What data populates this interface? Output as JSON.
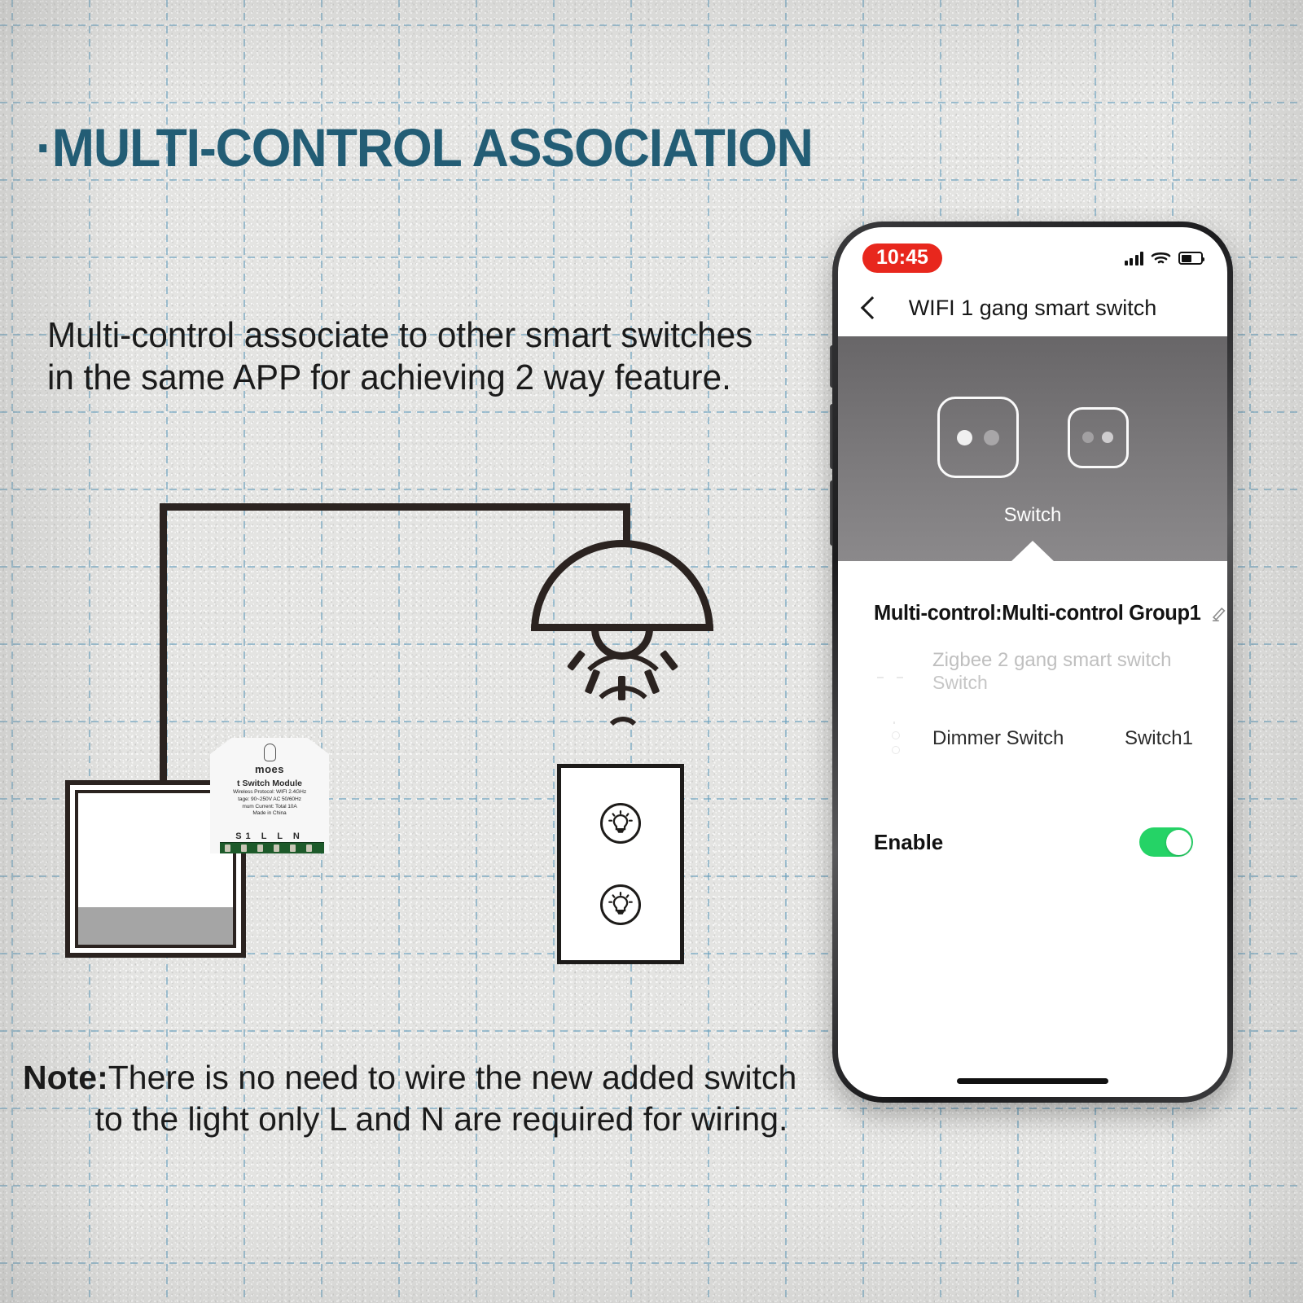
{
  "page": {
    "title": "·MULTI-CONTROL ASSOCIATION",
    "title_color": "#235d75",
    "body_line1": "Multi-control associate to other smart switches",
    "body_line2": "in the same APP for achieving 2 way feature.",
    "note_lead": "Note:",
    "note_line1": "There is no need to wire the new added switch",
    "note_line2": "to the light only L and N are required for wiring."
  },
  "diagram": {
    "module": {
      "brand": "moes",
      "model": "t Switch Module",
      "spec_protocol": "Wireless Protocol: WIFI 2.4GHz",
      "spec_voltage": "tage: 90~250V AC 50/60Hz",
      "spec_current": "mum Current: Total 10A",
      "origin": "Made in China",
      "terminals": "S1 L L N"
    },
    "lamp_icon": "ceiling-lamp-icon",
    "wifi_icon": "wifi-signal-icon",
    "left_switch_icon": "blank-wall-switch",
    "right_switch_icon": "two-button-wall-switch"
  },
  "phone": {
    "status_bar": {
      "time": "10:45",
      "time_pill_color": "#e8271d",
      "signal_icon": "cellular-signal-icon",
      "wifi_icon": "wifi-icon",
      "battery_icon": "battery-icon"
    },
    "nav": {
      "back_icon": "back-chevron-icon",
      "title": "WIFI 1 gang smart switch"
    },
    "hero": {
      "device_label": "Switch",
      "tiles": [
        {
          "name": "primary-switch-tile",
          "selected": true
        },
        {
          "name": "secondary-switch-tile",
          "selected": false
        }
      ]
    },
    "group": {
      "title": "Multi-control:Multi-control Group1",
      "edit_icon": "pencil-edit-icon",
      "add_icon": "plus-icon",
      "add_button_color": "#4a89f3"
    },
    "devices": [
      {
        "name": "Zigbee 2 gang smart switch",
        "sub": "Switch",
        "value": "",
        "muted": true
      },
      {
        "name": "Dimmer Switch",
        "sub": "",
        "value": "Switch1",
        "muted": false
      }
    ],
    "enable": {
      "label": "Enable",
      "state": "on",
      "toggle_color": "#25d366"
    }
  }
}
